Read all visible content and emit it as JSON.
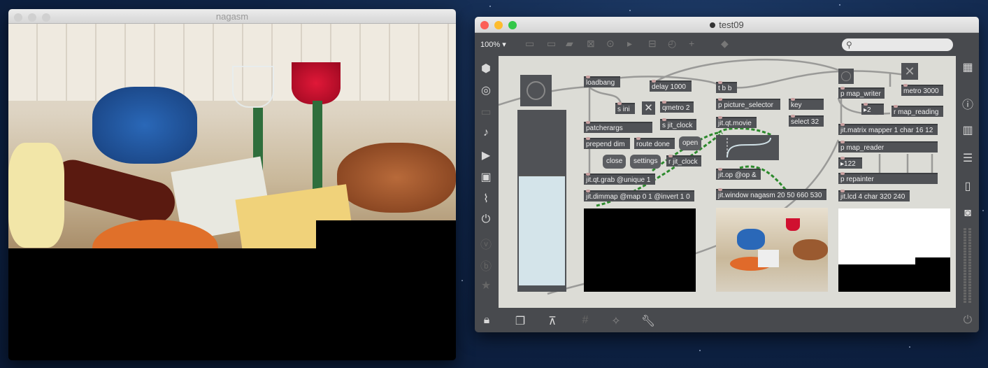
{
  "left_window": {
    "title": "nagasm"
  },
  "right_window": {
    "title": "test09",
    "zoom": "100%"
  },
  "objects": {
    "loadbang": "loadbang",
    "delay": "delay 1000",
    "s_ini": "s ini",
    "qmetro": "qmetro 2",
    "s_jit_clock": "s jit_clock",
    "patcherargs": "patcherargs",
    "prepend_dim": "prepend dim",
    "route_done": "route done",
    "open": "open",
    "close": "close",
    "settings": "settings",
    "r_jit_clock": "r jit_clock",
    "jit_qt_grab": "jit.qt.grab @unique 1",
    "jit_dimmap": "jit.dimmap @map 0 1 @invert 1 0",
    "tbb": "t b b",
    "picture_selector": "p picture_selector",
    "key": "key",
    "select32": "select 32",
    "jit_qt_movie": "jit.qt.movie",
    "jit_op": "jit.op @op &",
    "jit_window": "jit.window nagasm 20 50 660 530",
    "map_writer": "p map_writer",
    "metro3000": "metro 3000",
    "num2": "2",
    "r_map_reading": "r map_reading",
    "jit_matrix": "jit.matrix mapper 1 char 16 12",
    "map_reader": "p map_reader",
    "num122": "122",
    "repainter": "p repainter",
    "jit_lcd": "jit.lcd 4 char 320 240"
  },
  "toggles": {
    "left": true,
    "right": true
  },
  "slider": {
    "value_fraction": 0.63
  }
}
